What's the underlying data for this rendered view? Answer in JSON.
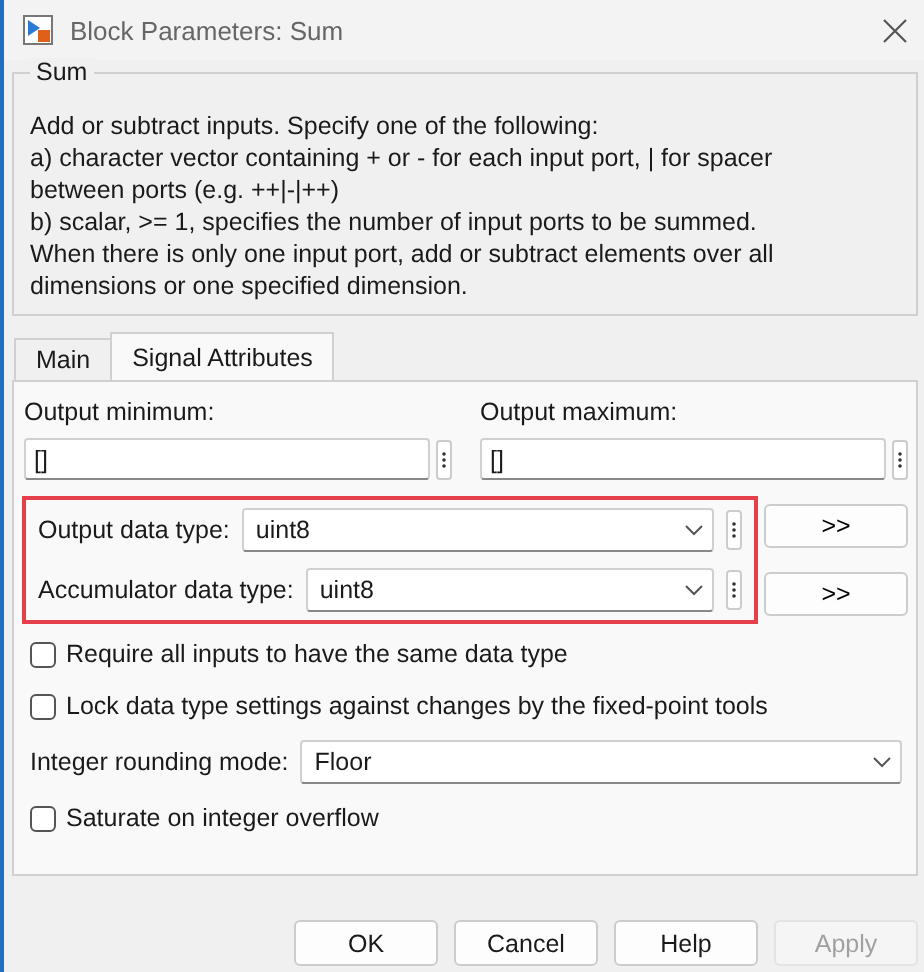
{
  "window": {
    "title": "Block Parameters: Sum"
  },
  "block": {
    "name": "Sum",
    "description": [
      "Add or subtract inputs.  Specify one of the following:",
      "a) character vector containing + or - for each input port, | for spacer",
      "between ports (e.g. ++|-|++)",
      "b) scalar, >= 1, specifies the number of input ports to be summed.",
      "When there is only one input port, add or subtract elements over all",
      "dimensions or one specified dimension."
    ]
  },
  "tabs": [
    {
      "label": "Main",
      "selected": false
    },
    {
      "label": "Signal Attributes",
      "selected": true
    }
  ],
  "range_fields": [
    {
      "label": "Output minimum:",
      "value": "[]"
    },
    {
      "label": "Output maximum:",
      "value": "[]"
    }
  ],
  "data_types": {
    "highlighted": true,
    "rows": [
      {
        "label": "Output data type:",
        "value": "uint8",
        "assistant": ">>"
      },
      {
        "label": "Accumulator data type:",
        "value": "uint8",
        "assistant": ">>"
      }
    ]
  },
  "options": [
    {
      "kind": "checkbox",
      "label": "Require all inputs to have the same data type",
      "checked": false
    },
    {
      "kind": "checkbox",
      "label": "Lock data type settings against changes by the fixed-point tools",
      "checked": false
    },
    {
      "kind": "dropdown",
      "label": "Integer rounding mode:",
      "value": "Floor"
    },
    {
      "kind": "checkbox",
      "label": "Saturate on integer overflow",
      "checked": false
    }
  ],
  "buttons": [
    {
      "label": "OK",
      "disabled": false
    },
    {
      "label": "Cancel",
      "disabled": false
    },
    {
      "label": "Help",
      "disabled": false
    },
    {
      "label": "Apply",
      "disabled": true
    }
  ]
}
